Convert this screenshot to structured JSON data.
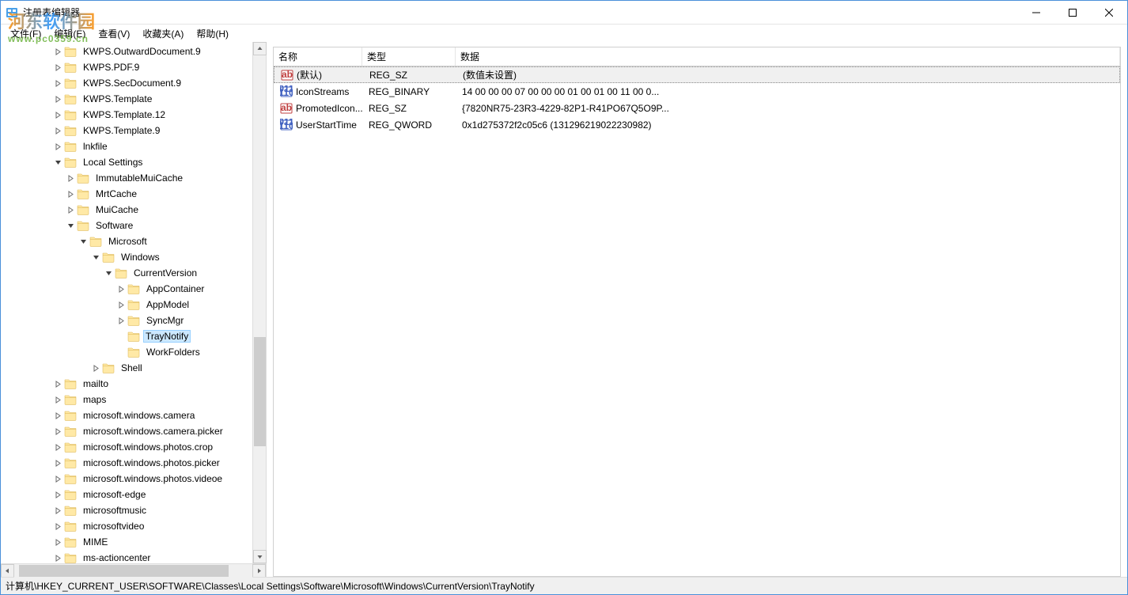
{
  "window": {
    "title": "注册表编辑器"
  },
  "menus": [
    {
      "label": "文件(F)"
    },
    {
      "label": "编辑(E)"
    },
    {
      "label": "查看(V)"
    },
    {
      "label": "收藏夹(A)"
    },
    {
      "label": "帮助(H)"
    }
  ],
  "watermark": {
    "brand": "河东软件园",
    "url": "www.pc0359.cn"
  },
  "tree": [
    {
      "indent": 4,
      "exp": ">",
      "label": "KWPS.OutwardDocument.9"
    },
    {
      "indent": 4,
      "exp": ">",
      "label": "KWPS.PDF.9"
    },
    {
      "indent": 4,
      "exp": ">",
      "label": "KWPS.SecDocument.9"
    },
    {
      "indent": 4,
      "exp": ">",
      "label": "KWPS.Template"
    },
    {
      "indent": 4,
      "exp": ">",
      "label": "KWPS.Template.12"
    },
    {
      "indent": 4,
      "exp": ">",
      "label": "KWPS.Template.9"
    },
    {
      "indent": 4,
      "exp": ">",
      "label": "lnkfile"
    },
    {
      "indent": 4,
      "exp": "v",
      "label": "Local Settings"
    },
    {
      "indent": 5,
      "exp": ">",
      "label": "ImmutableMuiCache"
    },
    {
      "indent": 5,
      "exp": ">",
      "label": "MrtCache"
    },
    {
      "indent": 5,
      "exp": ">",
      "label": "MuiCache"
    },
    {
      "indent": 5,
      "exp": "v",
      "label": "Software"
    },
    {
      "indent": 6,
      "exp": "v",
      "label": "Microsoft"
    },
    {
      "indent": 7,
      "exp": "v",
      "label": "Windows"
    },
    {
      "indent": 8,
      "exp": "v",
      "label": "CurrentVersion"
    },
    {
      "indent": 9,
      "exp": ">",
      "label": "AppContainer"
    },
    {
      "indent": 9,
      "exp": ">",
      "label": "AppModel"
    },
    {
      "indent": 9,
      "exp": ">",
      "label": "SyncMgr"
    },
    {
      "indent": 9,
      "exp": "",
      "label": "TrayNotify",
      "selected": true
    },
    {
      "indent": 9,
      "exp": "",
      "label": "WorkFolders"
    },
    {
      "indent": 7,
      "exp": ">",
      "label": "Shell"
    },
    {
      "indent": 4,
      "exp": ">",
      "label": "mailto"
    },
    {
      "indent": 4,
      "exp": ">",
      "label": "maps"
    },
    {
      "indent": 4,
      "exp": ">",
      "label": "microsoft.windows.camera"
    },
    {
      "indent": 4,
      "exp": ">",
      "label": "microsoft.windows.camera.picker"
    },
    {
      "indent": 4,
      "exp": ">",
      "label": "microsoft.windows.photos.crop"
    },
    {
      "indent": 4,
      "exp": ">",
      "label": "microsoft.windows.photos.picker"
    },
    {
      "indent": 4,
      "exp": ">",
      "label": "microsoft.windows.photos.videoe"
    },
    {
      "indent": 4,
      "exp": ">",
      "label": "microsoft-edge"
    },
    {
      "indent": 4,
      "exp": ">",
      "label": "microsoftmusic"
    },
    {
      "indent": 4,
      "exp": ">",
      "label": "microsoftvideo"
    },
    {
      "indent": 4,
      "exp": ">",
      "label": "MIME"
    },
    {
      "indent": 4,
      "exp": ">",
      "label": "ms-actioncenter"
    }
  ],
  "columns": {
    "name": "名称",
    "type": "类型",
    "data": "数据"
  },
  "values": [
    {
      "icon": "string",
      "name": "(默认)",
      "type": "REG_SZ",
      "data": "(数值未设置)",
      "selected": true
    },
    {
      "icon": "binary",
      "name": "IconStreams",
      "type": "REG_BINARY",
      "data": "14 00 00 00 07 00 00 00 01 00 01 00 11 00 0..."
    },
    {
      "icon": "string",
      "name": "PromotedIcon...",
      "type": "REG_SZ",
      "data": "{7820NR75-23R3-4229-82P1-R41PO67Q5O9P..."
    },
    {
      "icon": "binary",
      "name": "UserStartTime",
      "type": "REG_QWORD",
      "data": "0x1d275372f2c05c6 (131296219022230982)"
    }
  ],
  "status": "计算机\\HKEY_CURRENT_USER\\SOFTWARE\\Classes\\Local Settings\\Software\\Microsoft\\Windows\\CurrentVersion\\TrayNotify",
  "icons": {
    "reg_app": "reg",
    "folder": "folder"
  }
}
